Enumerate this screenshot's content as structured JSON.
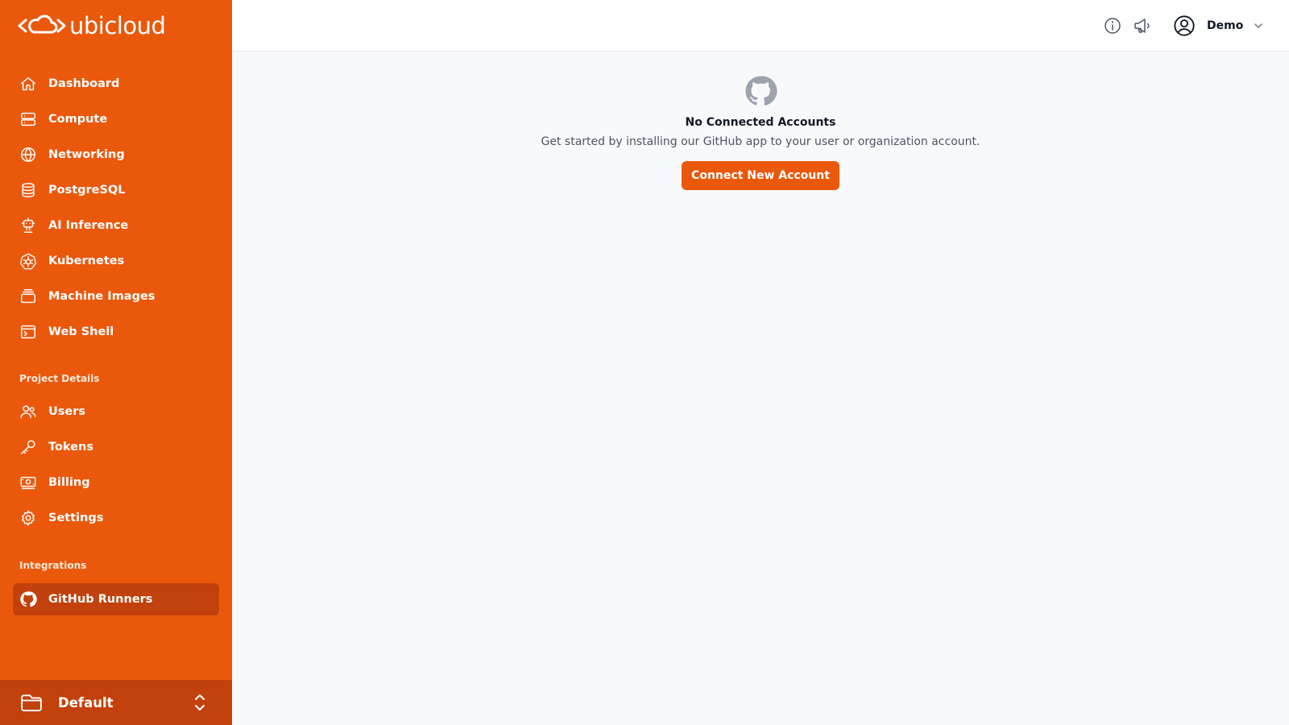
{
  "brand": {
    "name": "ubicloud",
    "accent": "#ea580c",
    "accent_dark": "#c2410c"
  },
  "sidebar": {
    "main_items": [
      {
        "label": "Dashboard",
        "icon": "home-icon"
      },
      {
        "label": "Compute",
        "icon": "server-icon"
      },
      {
        "label": "Networking",
        "icon": "globe-icon"
      },
      {
        "label": "PostgreSQL",
        "icon": "database-icon"
      },
      {
        "label": "AI Inference",
        "icon": "robot-icon"
      },
      {
        "label": "Kubernetes",
        "icon": "kubernetes-icon"
      },
      {
        "label": "Machine Images",
        "icon": "stack-icon"
      },
      {
        "label": "Web Shell",
        "icon": "terminal-icon"
      }
    ],
    "project_section_title": "Project Details",
    "project_items": [
      {
        "label": "Users",
        "icon": "users-icon"
      },
      {
        "label": "Tokens",
        "icon": "key-icon"
      },
      {
        "label": "Billing",
        "icon": "banknotes-icon"
      },
      {
        "label": "Settings",
        "icon": "cog-icon"
      }
    ],
    "integrations_section_title": "Integrations",
    "integration_items": [
      {
        "label": "GitHub Runners",
        "icon": "github-icon",
        "active": true
      }
    ],
    "project_switcher": {
      "name": "Default"
    }
  },
  "header": {
    "user": {
      "name": "Demo"
    }
  },
  "main": {
    "empty_state": {
      "title": "No Connected Accounts",
      "description": "Get started by installing our GitHub app to your user or organization account.",
      "button_label": "Connect New Account"
    }
  }
}
